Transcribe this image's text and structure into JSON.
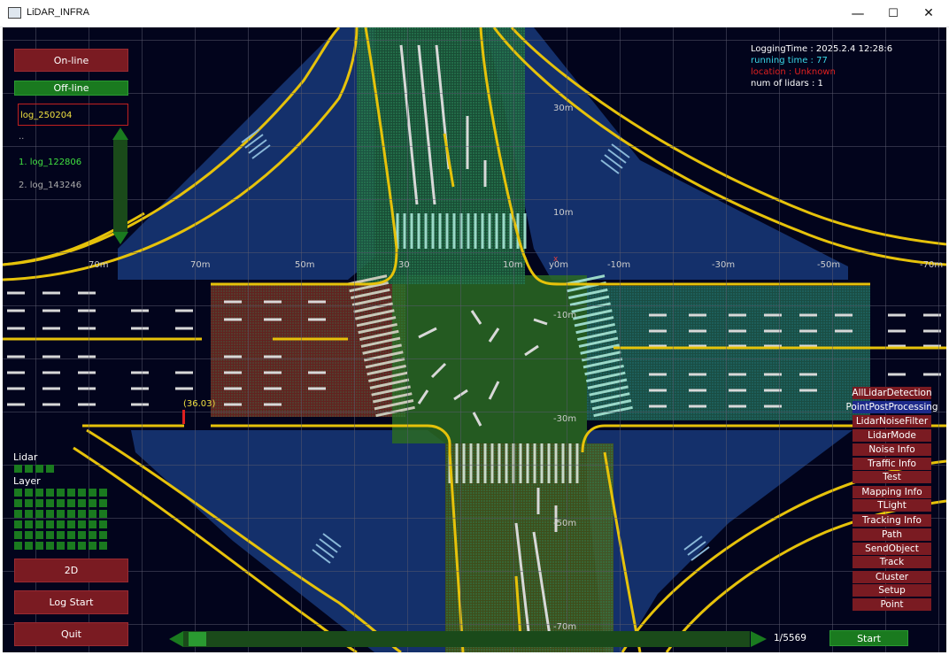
{
  "window": {
    "title": "LiDAR_INFRA",
    "min": "—",
    "max": "☐",
    "close": "✕"
  },
  "left_panel": {
    "online": "On-line",
    "offline": "Off-line",
    "log_input": "log_250204",
    "dotdot": "..",
    "logs": [
      "1. log_122806",
      "2. log_143246"
    ],
    "lidar_label": "Lidar",
    "layer_label": "Layer",
    "btn_2d": "2D",
    "btn_logstart": "Log Start",
    "btn_quit": "Quit"
  },
  "info": {
    "logging_time": "LoggingTime : 2025.2.4    12:28:6",
    "running_time": "running time : 77",
    "location": "location : Unknown",
    "num_lidars": "num of lidars : 1"
  },
  "scale_labels": {
    "h": [
      "70m",
      "70m",
      "50m",
      "30",
      "10m",
      "y0m",
      "-10m",
      "-30m",
      "-50m",
      "-70m"
    ],
    "v": [
      "30m",
      "10m",
      "-10m",
      "-30m",
      "-50m",
      "-70m"
    ],
    "marker": "(36.03)"
  },
  "right_menu": [
    "AllLidarDetection",
    "PointPostProcessing",
    "LidarNoiseFilter",
    "LidarMode",
    "Noise Info",
    "Traffic Info",
    "Test",
    "Mapping Info",
    "TLight",
    "Tracking Info",
    "Path",
    "SendObject",
    "Track",
    "Cluster",
    "Setup",
    "Point"
  ],
  "bottom": {
    "frame": "1/5569",
    "start": "Start",
    "progress": 0.0
  },
  "colors": {
    "bg": "#02041c",
    "road_line": "#e6c20a",
    "accent_red": "#7a1b22",
    "accent_green": "#1a7a1f"
  }
}
